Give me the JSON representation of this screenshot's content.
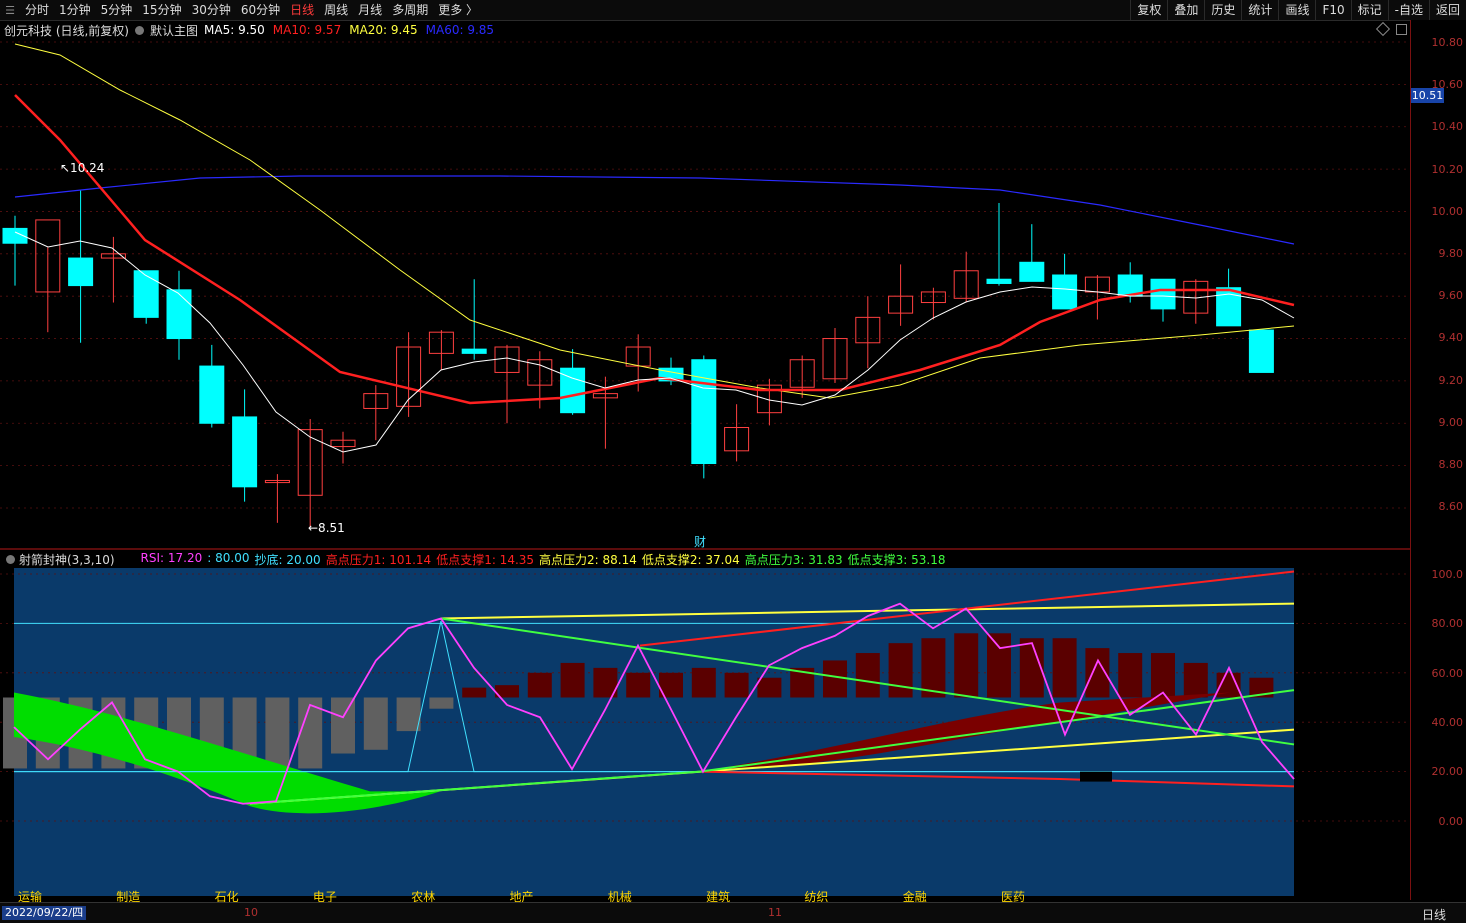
{
  "toolbar": {
    "periods": [
      "分时",
      "1分钟",
      "5分钟",
      "15分钟",
      "30分钟",
      "60分钟",
      "日线",
      "周线",
      "月线",
      "多周期",
      "更多 〉"
    ],
    "active_period": "日线",
    "tools": [
      "复权",
      "叠加",
      "历史",
      "统计",
      "画线",
      "F10",
      "标记",
      "-自选",
      "返回"
    ]
  },
  "main_chart": {
    "title": "创元科技 (日线,前复权)",
    "template": "默认主图",
    "ma": [
      {
        "label": "MA5: 9.50",
        "color": "#ffffff"
      },
      {
        "label": "MA10: 9.57",
        "color": "#ff2020"
      },
      {
        "label": "MA20: 9.45",
        "color": "#ffff40"
      },
      {
        "label": "MA60: 9.85",
        "color": "#2a2aff"
      }
    ],
    "high_marker": "10.24",
    "low_marker": "8.51",
    "event_marker": "财",
    "current_price": "10.51",
    "y_ticks": [
      "10.80",
      "10.60",
      "10.40",
      "10.20",
      "10.00",
      "9.80",
      "9.60",
      "9.40",
      "9.20",
      "9.00",
      "8.80",
      "8.60"
    ],
    "up_color": "#ff4040",
    "down_color": "#00ffff"
  },
  "sub_chart": {
    "title": "射箭封神(3,3,10)",
    "params": [
      {
        "label": "RSI: 17.20",
        "color": "#ff40ff"
      },
      {
        "label": ": 80.00",
        "color": "#40e0ff"
      },
      {
        "label": "抄底: 20.00",
        "color": "#40e0ff"
      },
      {
        "label": "高点压力1: 101.14",
        "color": "#ff2020"
      },
      {
        "label": "低点支撑1: 14.35",
        "color": "#ff2020"
      },
      {
        "label": "高点压力2: 88.14",
        "color": "#ffff40"
      },
      {
        "label": "低点支撑2: 37.04",
        "color": "#ffff40"
      },
      {
        "label": "高点压力3: 31.83",
        "color": "#40ff40"
      },
      {
        "label": "低点支撑3: 53.18",
        "color": "#40ff40"
      }
    ],
    "y_ticks": [
      "100.0",
      "80.00",
      "60.00",
      "40.00",
      "20.00",
      "0.00"
    ],
    "sectors": [
      "运输",
      "制造",
      "石化",
      "电子",
      "农林",
      "地产",
      "机械",
      "建筑",
      "纺织",
      "金融",
      "医药"
    ]
  },
  "bottom": {
    "date": "2022/09/22/四",
    "ticks": [
      "10",
      "11"
    ],
    "kline_type": "日线"
  }
}
